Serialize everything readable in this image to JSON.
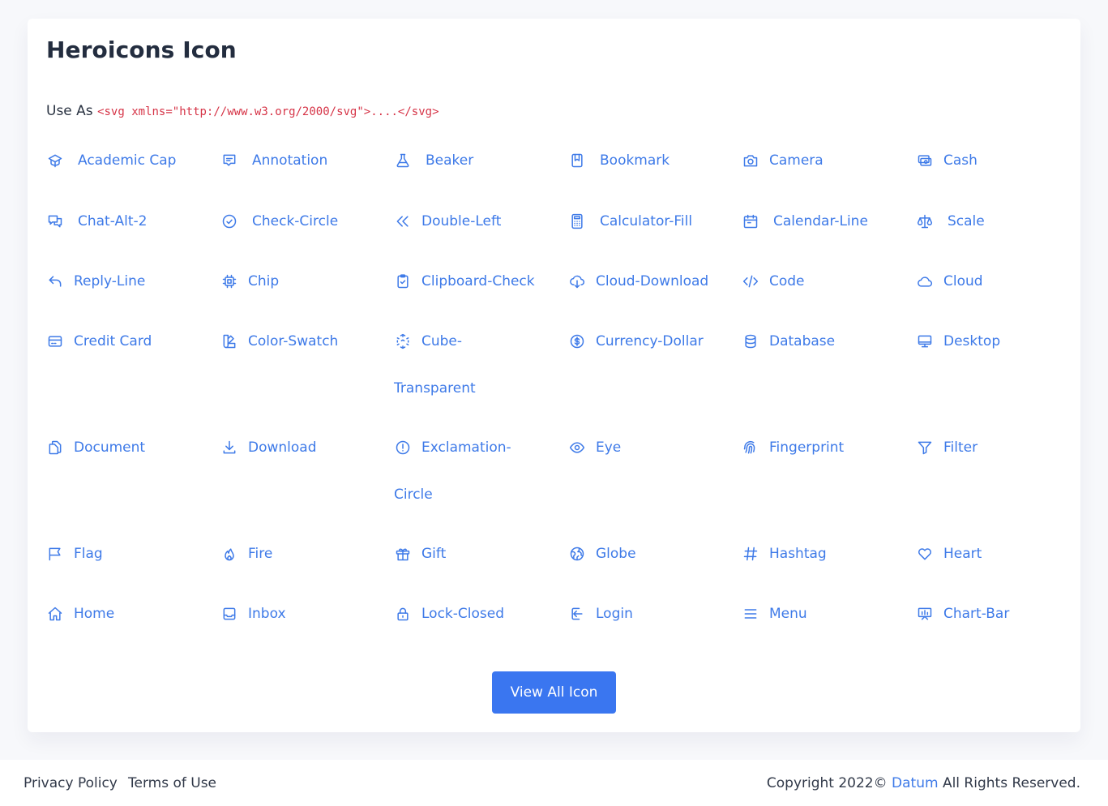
{
  "card": {
    "title": "Heroicons Icon",
    "use_as_label": "Use As",
    "use_as_code": "<svg xmlns=\"http://www.w3.org/2000/svg\">....</svg>"
  },
  "icons": [
    {
      "label": "Academic Cap",
      "icon": "academic-cap-icon"
    },
    {
      "label": "Annotation",
      "icon": "annotation-icon"
    },
    {
      "label": "Beaker",
      "icon": "beaker-icon"
    },
    {
      "label": "Bookmark",
      "icon": "bookmark-icon"
    },
    {
      "label": "Camera",
      "icon": "camera-icon"
    },
    {
      "label": "Cash",
      "icon": "cash-icon"
    },
    {
      "label": "Chat-Alt-2",
      "icon": "chat-alt-2-icon"
    },
    {
      "label": "Check-Circle",
      "icon": "check-circle-icon"
    },
    {
      "label": "Double-Left",
      "icon": "double-left-icon"
    },
    {
      "label": "Calculator-Fill",
      "icon": "calculator-icon"
    },
    {
      "label": "Calendar-Line",
      "icon": "calendar-icon"
    },
    {
      "label": "Scale",
      "icon": "scale-icon"
    },
    {
      "label": "Reply-Line",
      "icon": "reply-icon"
    },
    {
      "label": "Chip",
      "icon": "chip-icon"
    },
    {
      "label": "Clipboard-Check",
      "icon": "clipboard-check-icon"
    },
    {
      "label": "Cloud-Download",
      "icon": "cloud-download-icon"
    },
    {
      "label": "Code",
      "icon": "code-icon"
    },
    {
      "label": "Cloud",
      "icon": "cloud-icon"
    },
    {
      "label": "Credit Card",
      "icon": "credit-card-icon"
    },
    {
      "label": "Color-Swatch",
      "icon": "color-swatch-icon"
    },
    {
      "label": "Cube-",
      "label_line2": "Transparent",
      "icon": "cube-transparent-icon"
    },
    {
      "label": "Currency-Dollar",
      "icon": "currency-dollar-icon"
    },
    {
      "label": "Database",
      "icon": "database-icon"
    },
    {
      "label": "Desktop",
      "icon": "desktop-icon"
    },
    {
      "label": "Document",
      "icon": "document-icon"
    },
    {
      "label": "Download",
      "icon": "download-icon"
    },
    {
      "label": "Exclamation-",
      "label_line2": "Circle",
      "icon": "exclamation-circle-icon"
    },
    {
      "label": "Eye",
      "icon": "eye-icon"
    },
    {
      "label": "Fingerprint",
      "icon": "fingerprint-icon"
    },
    {
      "label": "Filter",
      "icon": "filter-icon"
    },
    {
      "label": "Flag",
      "icon": "flag-icon"
    },
    {
      "label": "Fire",
      "icon": "fire-icon"
    },
    {
      "label": "Gift",
      "icon": "gift-icon"
    },
    {
      "label": "Globe",
      "icon": "globe-icon"
    },
    {
      "label": "Hashtag",
      "icon": "hashtag-icon"
    },
    {
      "label": "Heart",
      "icon": "heart-icon"
    },
    {
      "label": "Home",
      "icon": "home-icon"
    },
    {
      "label": "Inbox",
      "icon": "inbox-icon"
    },
    {
      "label": "Lock-Closed",
      "icon": "lock-closed-icon"
    },
    {
      "label": "Login",
      "icon": "login-icon"
    },
    {
      "label": "Menu",
      "icon": "menu-icon"
    },
    {
      "label": "Chart-Bar",
      "icon": "chart-bar-icon"
    }
  ],
  "button": {
    "view_all": "View All Icon"
  },
  "footer": {
    "privacy": "Privacy Policy",
    "terms": "Terms of Use",
    "copyright_prefix": "Copyright 2022©",
    "brand": "Datum",
    "copyright_suffix": "All Rights Reserved."
  },
  "colors": {
    "accent": "#3e7ae8",
    "button": "#3a76f0",
    "code": "#d63447",
    "background": "#f7f8fb"
  }
}
